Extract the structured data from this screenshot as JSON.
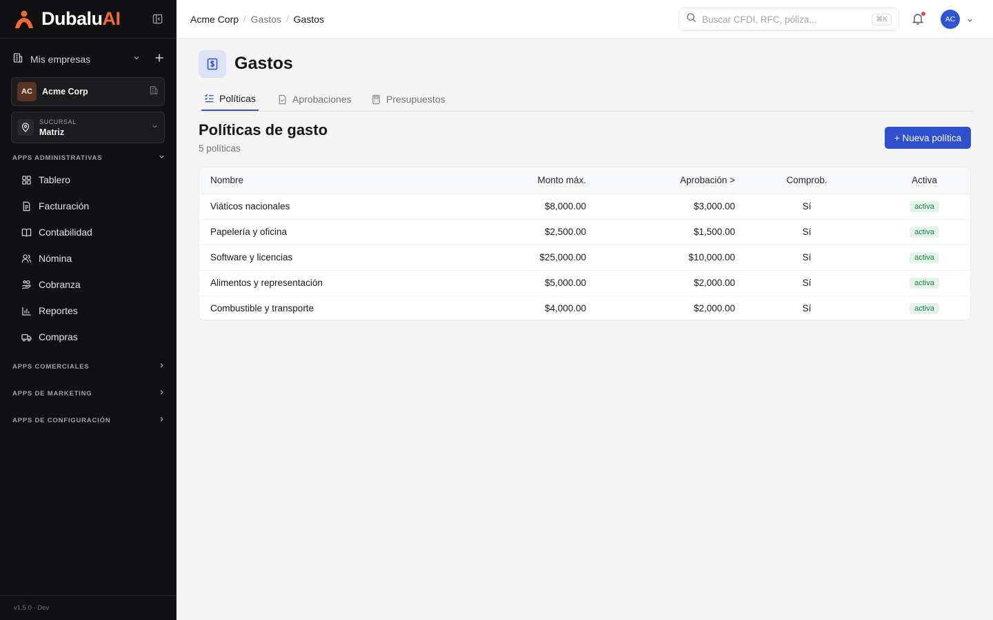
{
  "brand": {
    "name_primary": "Dubalu",
    "name_accent": "AI",
    "accent_color": "#f26a2e"
  },
  "sidebar": {
    "companies_label": "Mis empresas",
    "company": {
      "initials": "AC",
      "name": "Acme Corp"
    },
    "branch": {
      "label": "SUCURSAL",
      "value": "Matriz"
    },
    "sections": [
      {
        "label": "APPS ADMINISTRATIVAS",
        "expanded": true
      },
      {
        "label": "APPS COMERCIALES",
        "expanded": false
      },
      {
        "label": "APPS DE MARKETING",
        "expanded": false
      },
      {
        "label": "APPS DE CONFIGURACIÓN",
        "expanded": false
      }
    ],
    "items": [
      {
        "label": "Tablero",
        "icon": "grid-icon"
      },
      {
        "label": "Facturación",
        "icon": "invoice-icon"
      },
      {
        "label": "Contabilidad",
        "icon": "book-icon"
      },
      {
        "label": "Nómina",
        "icon": "users-icon"
      },
      {
        "label": "Cobranza",
        "icon": "hand-coins-icon"
      },
      {
        "label": "Reportes",
        "icon": "bar-chart-icon"
      },
      {
        "label": "Compras",
        "icon": "truck-icon"
      }
    ],
    "version": "v1.5.0 · Dev"
  },
  "topbar": {
    "breadcrumb": [
      "Acme Corp",
      "Gastos",
      "Gastos"
    ],
    "search_placeholder": "Buscar CFDI, RFC, póliza...",
    "search_shortcut": "⌘K",
    "user_initials": "AC"
  },
  "page": {
    "title": "Gastos",
    "tabs": [
      {
        "label": "Políticas",
        "active": true
      },
      {
        "label": "Aprobaciones",
        "active": false
      },
      {
        "label": "Presupuestos",
        "active": false
      }
    ],
    "section_title": "Políticas de gasto",
    "section_subtitle": "5 políticas",
    "new_button": "+ Nueva política"
  },
  "table": {
    "headers": {
      "nombre": "Nombre",
      "monto": "Monto máx.",
      "aprobacion": "Aprobación >",
      "comprob": "Comprob.",
      "activa": "Activa"
    },
    "rows": [
      {
        "nombre": "Viáticos nacionales",
        "monto": "$8,000.00",
        "aprobacion": "$3,000.00",
        "comprob": "Sí",
        "activa": "activa"
      },
      {
        "nombre": "Papelería y oficina",
        "monto": "$2,500.00",
        "aprobacion": "$1,500.00",
        "comprob": "Sí",
        "activa": "activa"
      },
      {
        "nombre": "Software y licencias",
        "monto": "$25,000.00",
        "aprobacion": "$10,000.00",
        "comprob": "Sí",
        "activa": "activa"
      },
      {
        "nombre": "Alimentos y representación",
        "monto": "$5,000.00",
        "aprobacion": "$2,000.00",
        "comprob": "Sí",
        "activa": "activa"
      },
      {
        "nombre": "Combustible y transporte",
        "monto": "$4,000.00",
        "aprobacion": "$2,000.00",
        "comprob": "Sí",
        "activa": "activa"
      }
    ]
  },
  "colors": {
    "primary": "#2f4fcf",
    "sidebar_bg": "#111113",
    "success": "#15803d"
  }
}
